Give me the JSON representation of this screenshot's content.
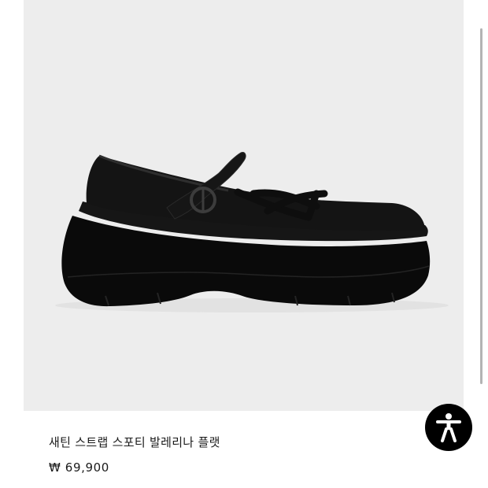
{
  "product": {
    "image_subject": "black satin mary-jane ballerina flat with chunky sole",
    "name": "새틴 스트랩 스포티 발레리나 플랫",
    "price": "₩ 69,900"
  },
  "accessibility_button": {
    "icon": "accessibility-person-icon"
  },
  "scroll": {
    "position": 0.0
  },
  "colors": {
    "image_background": "#ededed",
    "shoe": "#111111",
    "text": "#1a1a1a",
    "button": "#000000",
    "scrollbar": "#b4b4b4"
  }
}
